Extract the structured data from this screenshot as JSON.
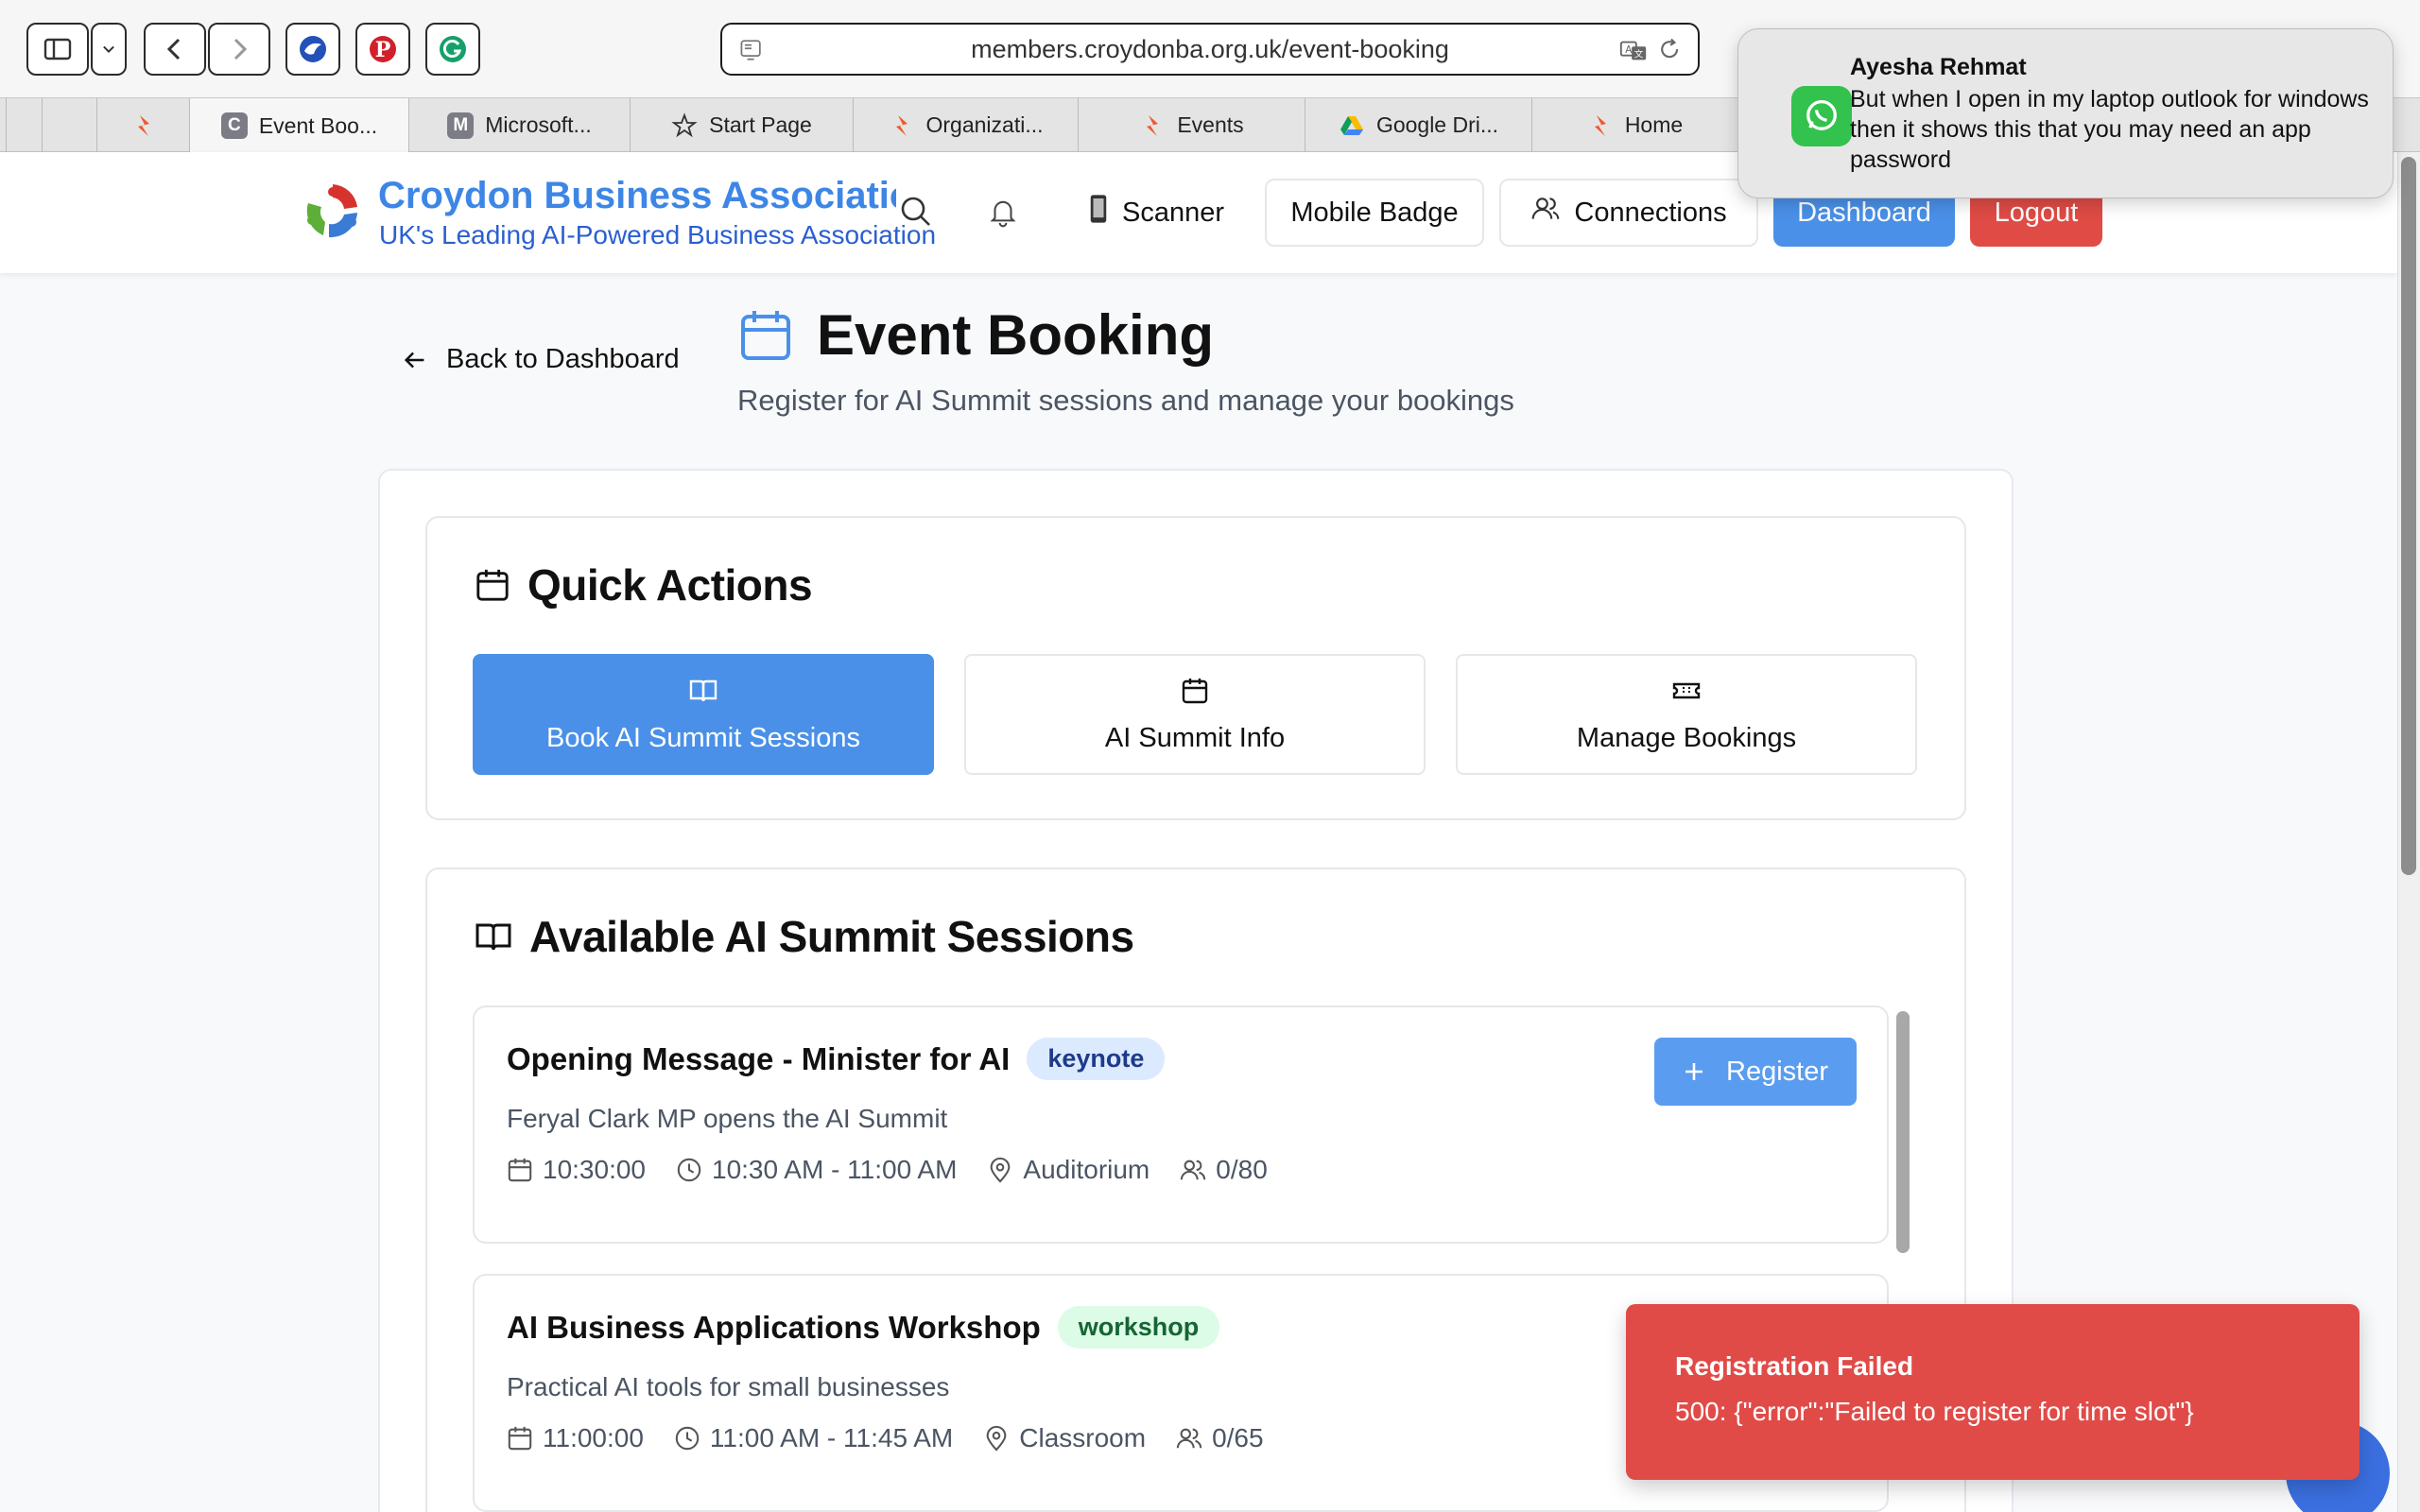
{
  "browser": {
    "url": "members.croydonba.org.uk/event-booking",
    "tabs": [
      {
        "label": "",
        "icon": "flame-icon"
      },
      {
        "label": "Event Boo...",
        "icon": "letter-c",
        "letter": "C",
        "active": true
      },
      {
        "label": "Microsoft...",
        "icon": "letter-m",
        "letter": "M"
      },
      {
        "label": "Start Page",
        "icon": "star-icon"
      },
      {
        "label": "Organizati...",
        "icon": "flame-icon"
      },
      {
        "label": "Events",
        "icon": "flame-icon"
      },
      {
        "label": "Google Dri...",
        "icon": "google-drive-icon"
      },
      {
        "label": "Home",
        "icon": "flame-icon"
      }
    ]
  },
  "header": {
    "brand_title": "Croydon Business Association",
    "brand_subtitle": "UK's Leading AI-Powered Business Association",
    "scanner_label": "Scanner",
    "mobile_badge_label": "Mobile Badge",
    "connections_label": "Connections",
    "dashboard_label": "Dashboard",
    "logout_label": "Logout"
  },
  "page": {
    "back_label": "Back to Dashboard",
    "title": "Event Booking",
    "subtitle": "Register for AI Summit sessions and manage your bookings"
  },
  "quick_actions": {
    "title": "Quick Actions",
    "buttons": [
      {
        "label": "Book AI Summit Sessions",
        "icon": "book-icon"
      },
      {
        "label": "AI Summit Info",
        "icon": "calendar-icon"
      },
      {
        "label": "Manage Bookings",
        "icon": "ticket-icon"
      }
    ]
  },
  "sessions": {
    "title": "Available AI Summit Sessions",
    "register_label": "Register",
    "items": [
      {
        "title": "Opening Message - Minister for AI",
        "badge": "keynote",
        "description": "Feryal Clark MP opens the AI Summit",
        "date": "10:30:00",
        "time": "10:30 AM - 11:00 AM",
        "location": "Auditorium",
        "capacity": "0/80"
      },
      {
        "title": "AI Business Applications Workshop",
        "badge": "workshop",
        "description": "Practical AI tools for small businesses",
        "date": "11:00:00",
        "time": "11:00 AM - 11:45 AM",
        "location": "Classroom",
        "capacity": "0/65"
      }
    ]
  },
  "notification": {
    "sender": "Ayesha Rehmat",
    "message": "But when I open in my laptop outlook for windows then it shows this that you may need an app password",
    "app_icon": "whatsapp-icon"
  },
  "error_toast": {
    "title": "Registration Failed",
    "body": "500: {\"error\":\"Failed to register for time slot\"}"
  },
  "colors": {
    "accent": "#4a90e8",
    "danger": "#e04b45",
    "brand": "#3d86e6"
  }
}
